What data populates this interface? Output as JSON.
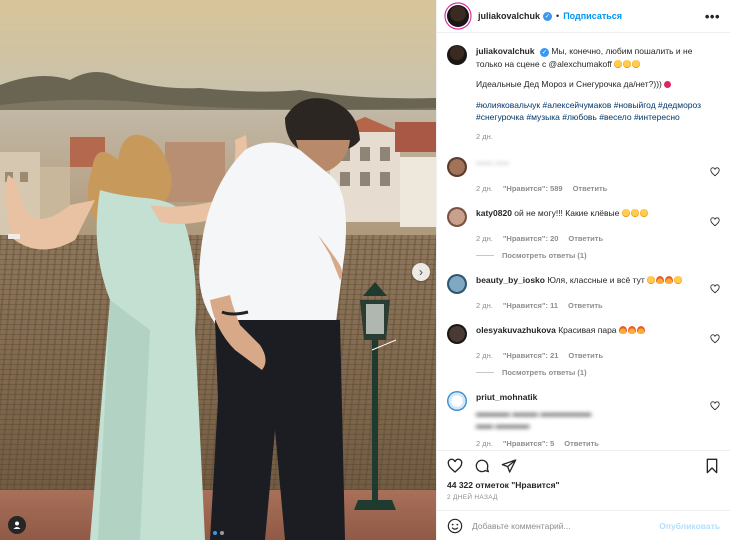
{
  "post": {
    "username": "juliakovalchuk",
    "separator": "•",
    "follow_label": "Подписаться",
    "more_label": "•••"
  },
  "caption": {
    "username": "juliakovalchuk",
    "text": "Мы, конечно, любим пошалить и не только на сцене с @alexchumakoff",
    "line2": "Идеальные Дед Мороз и Снегурочка да/нет?)))",
    "hashtags": "#юлияковальчук #алексейчумаков #новыйгод #дедмороз #снегурочка #музыка #любовь #весело #интересно",
    "time": "2 дн."
  },
  "comments": [
    {
      "username": "······ ·····",
      "text": "",
      "blurred": true,
      "time": "2 дн.",
      "likes": "\"Нравится\": 589",
      "reply": "Ответить",
      "view_replies": ""
    },
    {
      "username": "katy0820",
      "text": "ой не могу!!! Какие клёвые",
      "blurred": false,
      "time": "2 дн.",
      "likes": "\"Нравится\": 20",
      "reply": "Ответить",
      "view_replies": "Посмотреть ответы (1)"
    },
    {
      "username": "beauty_by_iosko",
      "text": "Юля, классные и всё тут",
      "blurred": false,
      "time": "2 дн.",
      "likes": "\"Нравится\": 11",
      "reply": "Ответить",
      "view_replies": ""
    },
    {
      "username": "olesyakuvazhukova",
      "text": "Красивая пара",
      "blurred": false,
      "time": "2 дн.",
      "likes": "\"Нравится\": 21",
      "reply": "Ответить",
      "view_replies": "Посмотреть ответы (1)"
    },
    {
      "username": "priut_mohnatik",
      "text": "",
      "blurred": true,
      "time": "2 дн.",
      "likes": "\"Нравится\": 5",
      "reply": "Ответить",
      "view_replies": ""
    }
  ],
  "footer": {
    "likes_count": "44 322 отметок \"Нравится\"",
    "date": "2 дней назад",
    "comment_placeholder": "Добавьте комментарий...",
    "post_label": "Опубликовать"
  },
  "colors": {
    "accent": "#0095f6",
    "hashtag": "#00376b",
    "muted": "#8e8e8e"
  },
  "icons": [
    "heart-icon",
    "comment-icon",
    "share-icon",
    "bookmark-icon",
    "emoji-icon",
    "chevron-right-icon",
    "tag-user-icon",
    "verified-icon"
  ],
  "carousel": {
    "count": 2,
    "active": 1
  }
}
